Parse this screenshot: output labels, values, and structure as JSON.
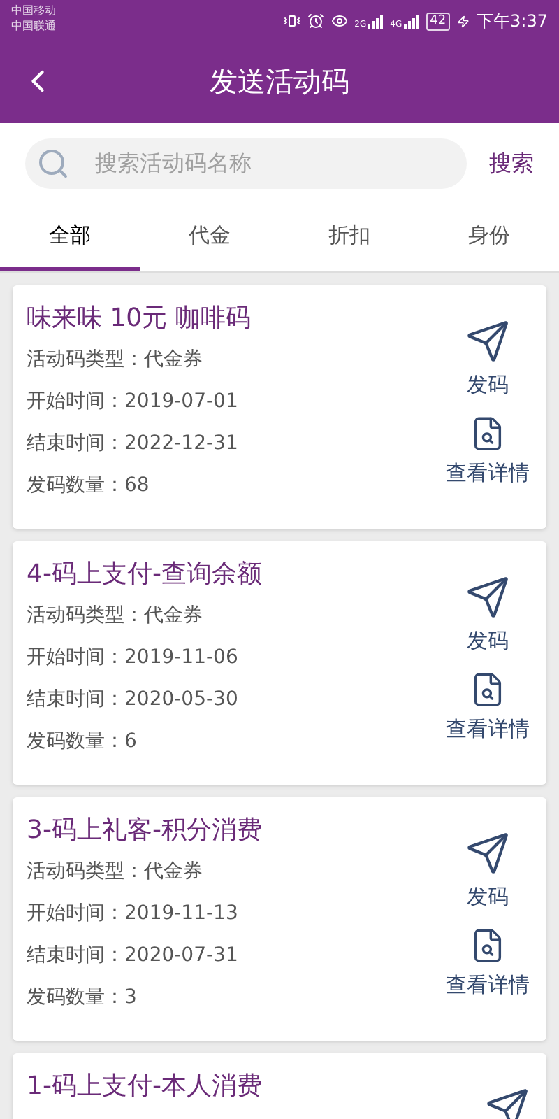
{
  "status_bar": {
    "carriers": [
      "中国移动",
      "中国联通"
    ],
    "network_1": "2G",
    "network_2": "4G",
    "battery": "42",
    "time": "下午3:37"
  },
  "header": {
    "title": "发送活动码"
  },
  "search": {
    "placeholder": "搜索活动码名称",
    "button": "搜索"
  },
  "tabs": [
    {
      "label": "全部",
      "selected": true
    },
    {
      "label": "代金",
      "selected": false
    },
    {
      "label": "折扣",
      "selected": false
    },
    {
      "label": "身份",
      "selected": false
    }
  ],
  "cards": [
    {
      "title": "味来味 10元 咖啡码",
      "fields": [
        {
          "label": "活动码类型：",
          "value": "代金券"
        },
        {
          "label": "开始时间：",
          "value": "2019-07-01"
        },
        {
          "label": "结束时间：",
          "value": "2022-12-31"
        },
        {
          "label": "发码数量：",
          "value": "68"
        }
      ],
      "actions": [
        {
          "kind": "send",
          "label": "发码"
        },
        {
          "kind": "details",
          "label": "查看详情"
        }
      ]
    },
    {
      "title": "4-码上支付-查询余额",
      "fields": [
        {
          "label": "活动码类型：",
          "value": "代金券"
        },
        {
          "label": "开始时间：",
          "value": "2019-11-06"
        },
        {
          "label": "结束时间：",
          "value": "2020-05-30"
        },
        {
          "label": "发码数量：",
          "value": "6"
        }
      ],
      "actions": [
        {
          "kind": "send",
          "label": "发码"
        },
        {
          "kind": "details",
          "label": "查看详情"
        }
      ]
    },
    {
      "title": "3-码上礼客-积分消费",
      "fields": [
        {
          "label": "活动码类型：",
          "value": "代金券"
        },
        {
          "label": "开始时间：",
          "value": "2019-11-13"
        },
        {
          "label": "结束时间：",
          "value": "2020-07-31"
        },
        {
          "label": "发码数量：",
          "value": "3"
        }
      ],
      "actions": [
        {
          "kind": "send",
          "label": "发码"
        },
        {
          "kind": "details",
          "label": "查看详情"
        }
      ]
    },
    {
      "title": "1-码上支付-本人消费",
      "actions": [
        {
          "kind": "send"
        }
      ]
    }
  ]
}
